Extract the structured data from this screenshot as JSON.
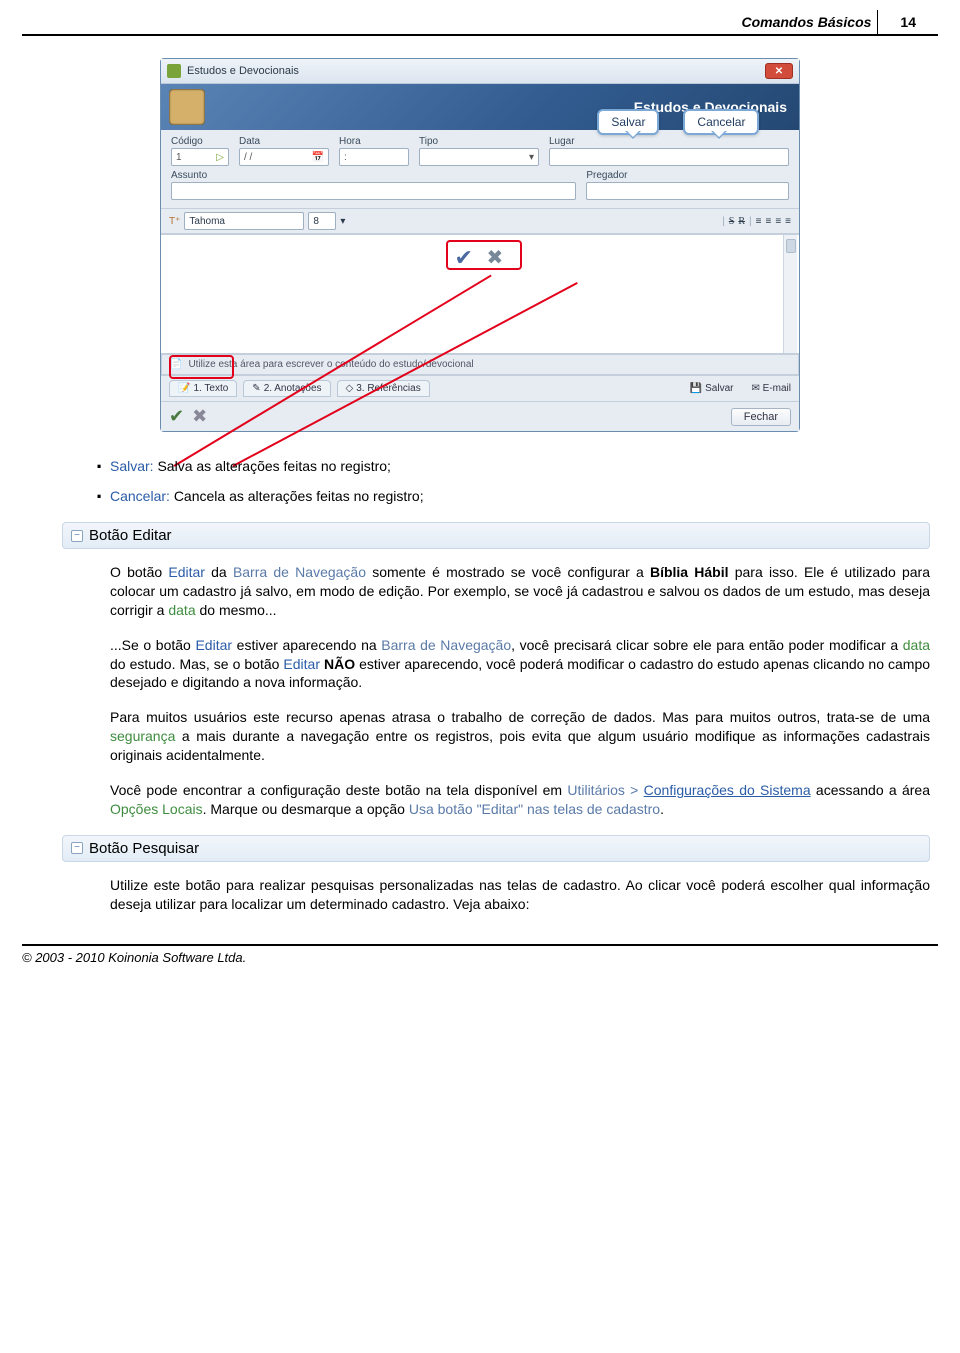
{
  "header": {
    "title": "Comandos Básicos",
    "page": "14"
  },
  "screenshot": {
    "window_title": "Estudos e Devocionais",
    "banner_title": "Estudos e Devocionais",
    "fields": {
      "codigo": {
        "label": "Código",
        "value": "1"
      },
      "data": {
        "label": "Data",
        "value": "/ /"
      },
      "hora": {
        "label": "Hora",
        "value": ":"
      },
      "tipo": {
        "label": "Tipo",
        "value": ""
      },
      "lugar": {
        "label": "Lugar",
        "value": ""
      },
      "assunto": {
        "label": "Assunto",
        "value": ""
      },
      "pregador": {
        "label": "Pregador",
        "value": ""
      }
    },
    "toolbar": {
      "font": "Tahoma",
      "size": "8",
      "s": "S",
      "r": "R"
    },
    "callouts": {
      "salvar": "Salvar",
      "cancelar": "Cancelar"
    },
    "content_hint": "Utilize esta área para escrever o conteúdo do estudo/devocional",
    "tabs": [
      "1. Texto",
      "2. Anotações",
      "3. Referências"
    ],
    "actions": {
      "salvar": "Salvar",
      "email": "E-mail"
    },
    "close_btn": "Fechar"
  },
  "bullets": {
    "salvar_label": "Salvar:",
    "salvar_text": "Salva as alterações feitas no registro;",
    "cancelar_label": "Cancelar:",
    "cancelar_text": "Cancela as alterações feitas no registro;"
  },
  "sections": {
    "editar_title": "Botão Editar",
    "pesquisar_title": "Botão Pesquisar"
  },
  "editar": {
    "p1_a": "O botão ",
    "p1_editar": "Editar",
    "p1_b": " da ",
    "p1_barra": "Barra de Navegação",
    "p1_c": " somente é mostrado se você configurar a ",
    "p1_bh": "Bíblia Hábil",
    "p1_d": " para isso. Ele é utilizado para colocar um cadastro já salvo, em modo de edição. Por exemplo, se você já cadastrou e salvou os dados de um estudo, mas deseja corrigir a ",
    "p1_data": "data",
    "p1_e": " do mesmo...",
    "p2_a": "...Se o botão ",
    "p2_b": " estiver aparecendo na ",
    "p2_c": ", você precisará clicar sobre ele para então poder modificar a ",
    "p2_d": " do estudo. Mas, se o botão ",
    "p2_nao": "NÃO",
    "p2_e": " estiver aparecendo, você poderá modificar o cadastro do estudo apenas clicando no campo desejado e digitando a nova informação.",
    "p3": "Para muitos usuários este recurso apenas atrasa o trabalho de correção de dados. Mas para muitos outros, trata-se de uma ",
    "p3_seg": "segurança",
    "p3b": " a mais durante a navegação entre os registros, pois evita que algum usuário modifique as informações cadastrais originais acidentalmente.",
    "p4a": "Você pode encontrar a configuração deste botão na tela disponível em ",
    "p4_util": "Utilitários > ",
    "p4_conf": "Configurações do Sistema",
    "p4b": " acessando a área ",
    "p4_opc": "Opções Locais",
    "p4c": ". Marque ou desmarque a opção ",
    "p4_usa": "Usa botão \"Editar\" nas telas de cadastro",
    "p4d": "."
  },
  "pesquisar": {
    "p1": "Utilize este botão para realizar pesquisas personalizadas nas telas de cadastro. Ao clicar você poderá escolher qual informação deseja utilizar para localizar um determinado cadastro. Veja abaixo:"
  },
  "footer": "© 2003 - 2010 Koinonia Software Ltda."
}
